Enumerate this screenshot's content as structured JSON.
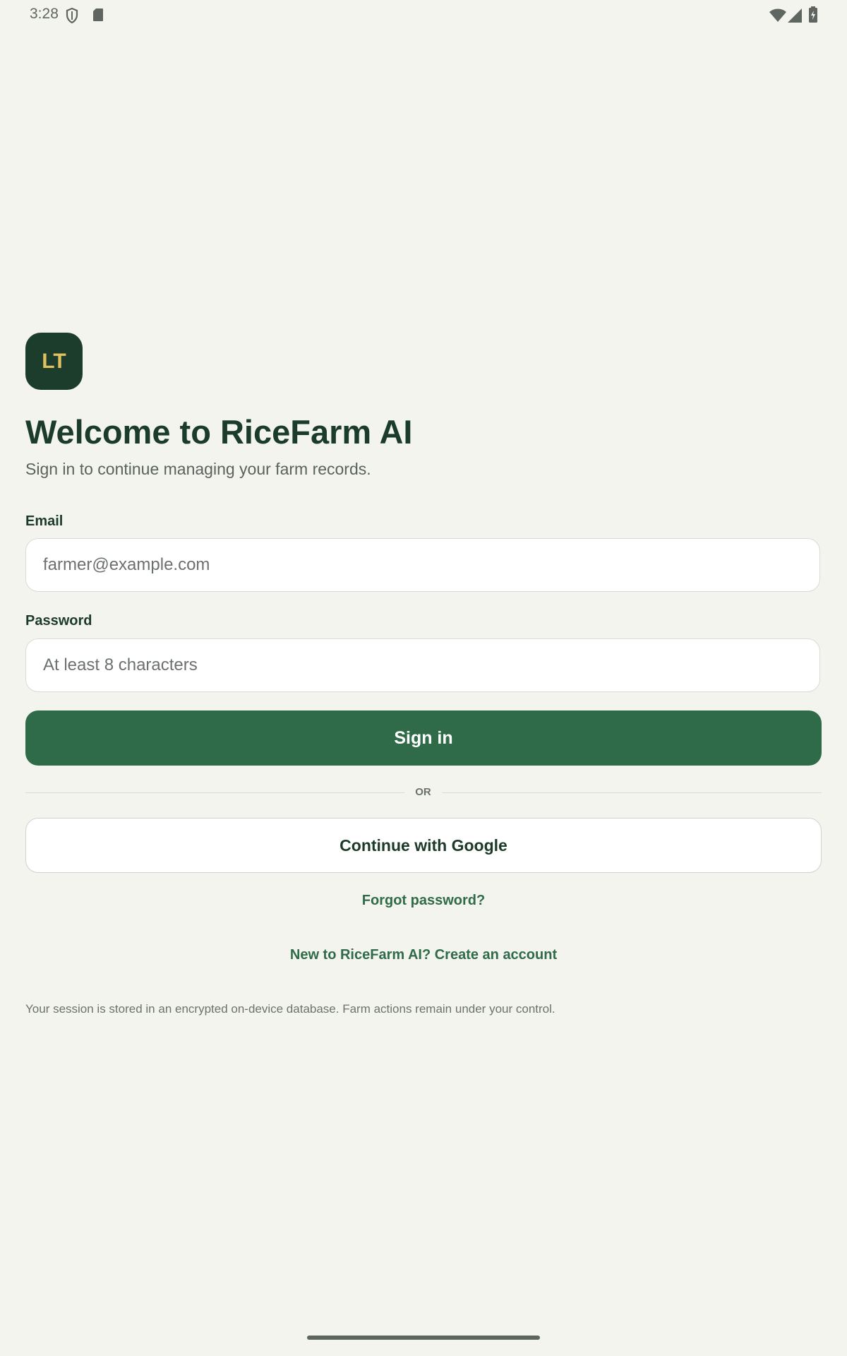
{
  "status_bar": {
    "time": "3:28"
  },
  "logo": {
    "initials": "LT"
  },
  "header": {
    "title": "Welcome to RiceFarm AI",
    "subtitle": "Sign in to continue managing your farm records."
  },
  "form": {
    "email_label": "Email",
    "email_placeholder": "farmer@example.com",
    "email_value": "",
    "password_label": "Password",
    "password_placeholder": "At least 8 characters",
    "password_value": "",
    "sign_in_label": "Sign in",
    "divider_text": "OR",
    "google_label": "Continue with Google",
    "forgot_label": "Forgot password?",
    "create_account_label": "New to RiceFarm AI? Create an account"
  },
  "footnote": "Your session is stored in an encrypted on-device database. Farm actions remain under your control.",
  "colors": {
    "background": "#f4f4ef",
    "primary": "#2f6b48",
    "dark_green": "#1c3d2b",
    "logo_text": "#e1c15f"
  },
  "icons": {
    "status": [
      "shield-icon",
      "sd-card-icon",
      "wifi-icon",
      "signal-icon",
      "battery-icon"
    ]
  }
}
